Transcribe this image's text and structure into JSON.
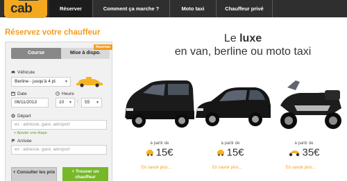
{
  "brand": {
    "logo_text": "cab",
    "accent": "#f39c1f",
    "green": "#76b82a"
  },
  "nav": {
    "items": [
      {
        "label": "Réserver",
        "active": true
      },
      {
        "label": "Comment ça marche ?"
      },
      {
        "label": "Moto taxi"
      },
      {
        "label": "Chauffeur privé"
      }
    ]
  },
  "booking": {
    "title": "Réservez votre chauffeur",
    "tabs": [
      {
        "label": "Course",
        "active": true
      },
      {
        "label": "Mise à dispo."
      }
    ],
    "new_badge": "Nouveau",
    "vehicle_label": "Véhicule",
    "vehicle_value": "Berline - jusqu'à 4 pl.",
    "date_label": "Date",
    "date_value": "06/11/2013",
    "time_label": "Heure",
    "hour_value": "10",
    "minute_value": "55",
    "departure_label": "Départ",
    "departure_placeholder": "ex : adresse, gare, aéroport",
    "add_stop": "+ Ajouter une étape",
    "arrival_label": "Arrivée",
    "arrival_placeholder": "ex : adresse, gare, aéroport",
    "btn_prices": "+ Consulter les prix",
    "btn_find": "+ Trouver un chauffeur"
  },
  "hero": {
    "title_pre": "Le ",
    "title_bold": "luxe",
    "title_line2": "en van, berline ou moto taxi",
    "offers": [
      {
        "from": "à partir de",
        "price": "15€",
        "link": "En savoir plus...",
        "icon": "taxi-badge-icon"
      },
      {
        "from": "à partir de",
        "price": "15€",
        "link": "En savoir plus...",
        "icon": "taxi-badge-icon"
      },
      {
        "from": "à partir de",
        "price": "35€",
        "link": "En savoir plus...",
        "icon": "moto-badge-icon"
      }
    ],
    "carousel_pages": 4,
    "carousel_active": 1
  }
}
